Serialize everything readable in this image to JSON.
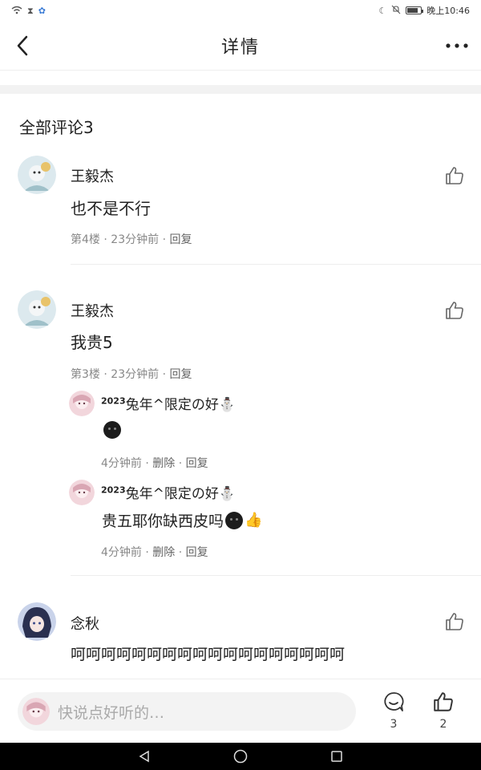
{
  "status_bar": {
    "time": "晚上10:46",
    "icons_left": [
      "wifi-icon",
      "hourglass-icon",
      "paw-icon"
    ],
    "icons_right": [
      "moon-icon",
      "mute-icon",
      "battery-icon"
    ],
    "battery_level": 0.8
  },
  "header": {
    "title": "详情"
  },
  "comments_section": {
    "title": "全部评论3"
  },
  "comments": [
    {
      "username": "王毅杰",
      "text": "也不是不行",
      "floor": "第4楼",
      "time": "23分钟前",
      "reply_label": "回复"
    },
    {
      "username": "王毅杰",
      "text": "我贵5",
      "floor": "第3楼",
      "time": "23分钟前",
      "reply_label": "回复",
      "replies": [
        {
          "name_sup": "2023",
          "name": "兔年^限定の好⛄",
          "text": "",
          "time": "4分钟前",
          "delete_label": "删除",
          "reply_label": "回复"
        },
        {
          "name_sup": "2023",
          "name": "兔年^限定の好⛄",
          "text": "贵五耶你缺西皮吗",
          "time": "4分钟前",
          "delete_label": "删除",
          "reply_label": "回复"
        }
      ]
    },
    {
      "username": "念秋",
      "text": "呵呵呵呵呵呵呵呵呵呵呵呵呵呵呵呵呵呵"
    }
  ],
  "bottom_bar": {
    "input_placeholder": "快说点好听的…",
    "comment_count": "3",
    "like_count": "2"
  },
  "separator": "·"
}
